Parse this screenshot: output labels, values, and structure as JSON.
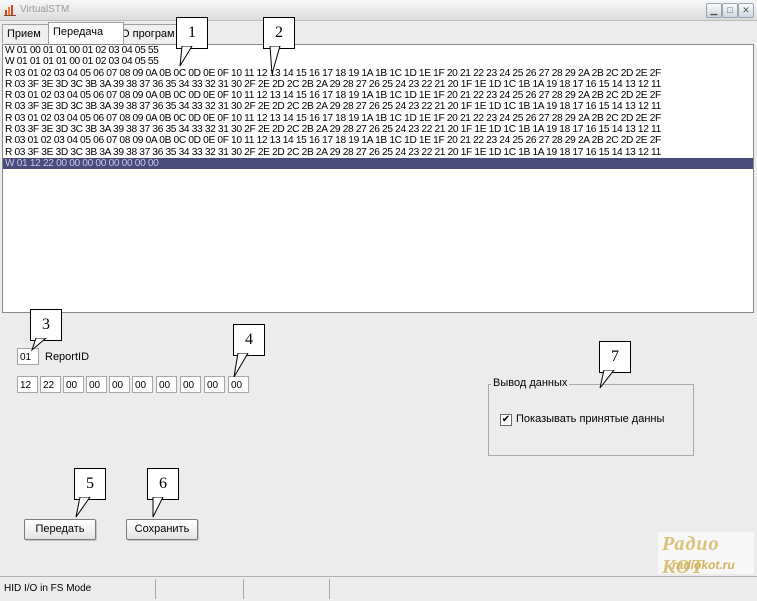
{
  "window": {
    "title": "VirtualSTM"
  },
  "tabs": [
    {
      "label": "Прием"
    },
    {
      "label": "Передача"
    },
    {
      "label": "О програм"
    }
  ],
  "log": {
    "lines": [
      "W 01  00 01 01 00 01 02 03 04 05 55",
      "W 01  01 01 01 00 01 02 03 04 05 55",
      "R 03  01 02 03 04 05 06 07 08 09 0A 0B 0C 0D 0E 0F 10 11 12 13 14 15 16 17 18 19 1A 1B 1C 1D 1E 1F 20 21 22 23 24 25 26 27 28 29 2A 2B 2C 2D 2E 2F",
      "R 03  3F 3E 3D 3C 3B 3A 39 38 37 36 35 34 33 32 31 30 2F 2E 2D 2C 2B 2A 29 28 27 26 25 24 23 22 21 20 1F 1E 1D 1C 1B 1A 19 18 17 16 15 14 13 12 11",
      "R 03  01 02 03 04 05 06 07 08 09 0A 0B 0C 0D 0E 0F 10 11 12 13 14 15 16 17 18 19 1A 1B 1C 1D 1E 1F 20 21 22 23 24 25 26 27 28 29 2A 2B 2C 2D 2E 2F",
      "R 03  3F 3E 3D 3C 3B 3A 39 38 37 36 35 34 33 32 31 30 2F 2E 2D 2C 2B 2A 29 28 27 26 25 24 23 22 21 20 1F 1E 1D 1C 1B 1A 19 18 17 16 15 14 13 12 11",
      "R 03  01 02 03 04 05 06 07 08 09 0A 0B 0C 0D 0E 0F 10 11 12 13 14 15 16 17 18 19 1A 1B 1C 1D 1E 1F 20 21 22 23 24 25 26 27 28 29 2A 2B 2C 2D 2E 2F",
      "R 03  3F 3E 3D 3C 3B 3A 39 38 37 36 35 34 33 32 31 30 2F 2E 2D 2C 2B 2A 29 28 27 26 25 24 23 22 21 20 1F 1E 1D 1C 1B 1A 19 18 17 16 15 14 13 12 11",
      "R 03  01 02 03 04 05 06 07 08 09 0A 0B 0C 0D 0E 0F 10 11 12 13 14 15 16 17 18 19 1A 1B 1C 1D 1E 1F 20 21 22 23 24 25 26 27 28 29 2A 2B 2C 2D 2E 2F",
      "R 03  3F 3E 3D 3C 3B 3A 39 38 37 36 35 34 33 32 31 30 2F 2E 2D 2C 2B 2A 29 28 27 26 25 24 23 22 21 20 1F 1E 1D 1C 1B 1A 19 18 17 16 15 14 13 12 11",
      "W 01  12 22 00 00 00 00 00 00 00 00"
    ]
  },
  "report": {
    "id_value": "01",
    "id_label": "ReportID",
    "bytes": [
      "12",
      "22",
      "00",
      "00",
      "00",
      "00",
      "00",
      "00",
      "00",
      "00"
    ]
  },
  "buttons": {
    "send": "Передать",
    "save": "Сохранить"
  },
  "output_group": {
    "title": "Вывод данных",
    "checkbox_label": "Показывать принятые данны",
    "checked": true,
    "check_mark": "✔"
  },
  "callouts": [
    "1",
    "2",
    "3",
    "4",
    "5",
    "6",
    "7"
  ],
  "status": {
    "mode": "HID I/O in FS Mode"
  },
  "watermark": {
    "top": "Радио КОТ",
    "bottom": "radiokot.ru"
  },
  "colors": {
    "selection": "#4b4b7c",
    "watermark": "#d9c27a"
  }
}
